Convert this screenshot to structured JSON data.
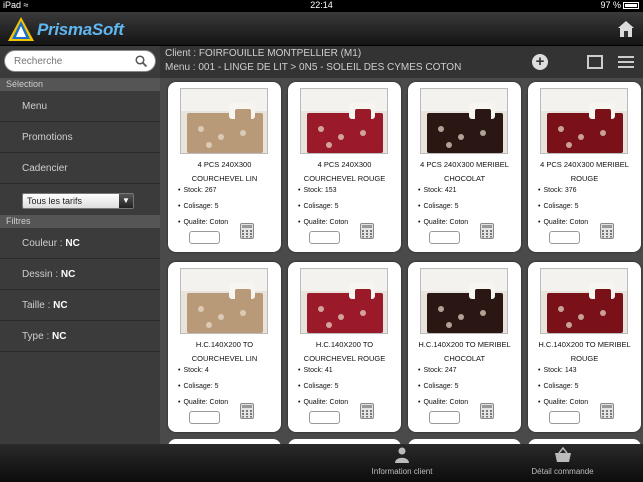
{
  "status_bar": {
    "device": "iPad",
    "time": "22:14",
    "battery": "97 %"
  },
  "app": {
    "name": "PrismaSoft"
  },
  "search": {
    "placeholder": "Recherche"
  },
  "sidebar": {
    "selection_header": "Sélection",
    "menu_items": [
      {
        "label": "Menu"
      },
      {
        "label": "Promotions"
      },
      {
        "label": "Cadencier"
      }
    ],
    "tariff_select": "Tous les tarifs",
    "filters_header": "Filtres",
    "filters": [
      {
        "label": "Couleur : ",
        "value": "NC"
      },
      {
        "label": "Dessin : ",
        "value": "NC"
      },
      {
        "label": "Taille : ",
        "value": "NC"
      },
      {
        "label": "Type : ",
        "value": "NC"
      }
    ]
  },
  "header": {
    "client": "Client : FOIRFOUILLE MONTPELLIER (M1)",
    "menu_path": "Menu : 001 - LINGE DE LIT > 0N5 - SOLEIL DES CYMES COTON"
  },
  "products": [
    {
      "name_line1": "4 PCS 240X300",
      "name_line2": "COURCHEVEL LIN",
      "stock": "Stock: 267",
      "colisage": "Colisage: 5",
      "qualite": "Qualite: Coton",
      "color": "#b89a78"
    },
    {
      "name_line1": "4 PCS 240X300",
      "name_line2": "COURCHEVEL ROUGE",
      "stock": "Stock: 153",
      "colisage": "Colisage: 5",
      "qualite": "Qualite: Coton",
      "color": "#9a1a2a"
    },
    {
      "name_line1": "4 PCS 240X300 MERIBEL",
      "name_line2": "CHOCOLAT",
      "stock": "Stock: 421",
      "colisage": "Colisage: 5",
      "qualite": "Qualite: Coton",
      "color": "#2a1612"
    },
    {
      "name_line1": "4 PCS 240X300 MERIBEL",
      "name_line2": "ROUGE",
      "stock": "Stock: 376",
      "colisage": "Colisage: 5",
      "qualite": "Qualite: Coton",
      "color": "#7a1018"
    },
    {
      "name_line1": "H.C.140X200 TO",
      "name_line2": "COURCHEVEL LIN",
      "stock": "Stock: 4",
      "colisage": "Colisage: 5",
      "qualite": "Qualite: Coton",
      "color": "#b89a78"
    },
    {
      "name_line1": "H.C.140X200 TO",
      "name_line2": "COURCHEVEL ROUGE",
      "stock": "Stock: 41",
      "colisage": "Colisage: 5",
      "qualite": "Qualite: Coton",
      "color": "#9a1a2a"
    },
    {
      "name_line1": "H.C.140X200 TO MERIBEL",
      "name_line2": "CHOCOLAT",
      "stock": "Stock: 247",
      "colisage": "Colisage: 5",
      "qualite": "Qualite: Coton",
      "color": "#2a1612"
    },
    {
      "name_line1": "H.C.140X200 TO MERIBEL",
      "name_line2": "ROUGE",
      "stock": "Stock: 143",
      "colisage": "Colisage: 5",
      "qualite": "Qualite: Coton",
      "color": "#7a1018"
    }
  ],
  "bottom_bar": {
    "info_client": "Information client",
    "detail_commande": "Détail commande"
  }
}
